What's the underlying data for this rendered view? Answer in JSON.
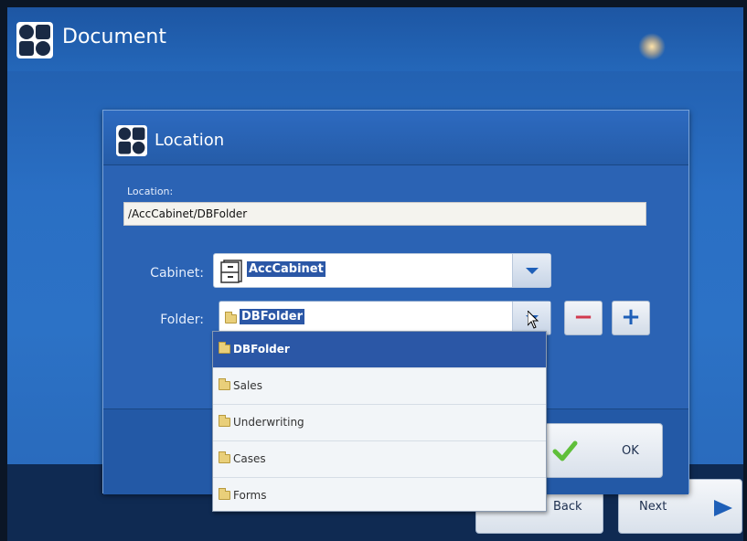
{
  "app": {
    "title": "Document"
  },
  "dialog": {
    "title": "Location",
    "location_label": "Location:",
    "location_value": "/AccCabinet/DBFolder",
    "cabinet_label": "Cabinet:",
    "cabinet_value": "AccCabinet",
    "folder_label": "Folder:",
    "folder_value": "DBFolder",
    "minus_label": "−",
    "plus_label": "+",
    "ok_label": "OK"
  },
  "folder_options": [
    "DBFolder",
    "Sales",
    "Underwriting",
    "Cases",
    "Forms"
  ],
  "nav": {
    "back_label": "Back",
    "next_label": "Next"
  },
  "colors": {
    "accent": "#2b57a6",
    "minus": "#d23a4e",
    "plus": "#1e5fb8",
    "ok_check": "#5fbf3a"
  }
}
